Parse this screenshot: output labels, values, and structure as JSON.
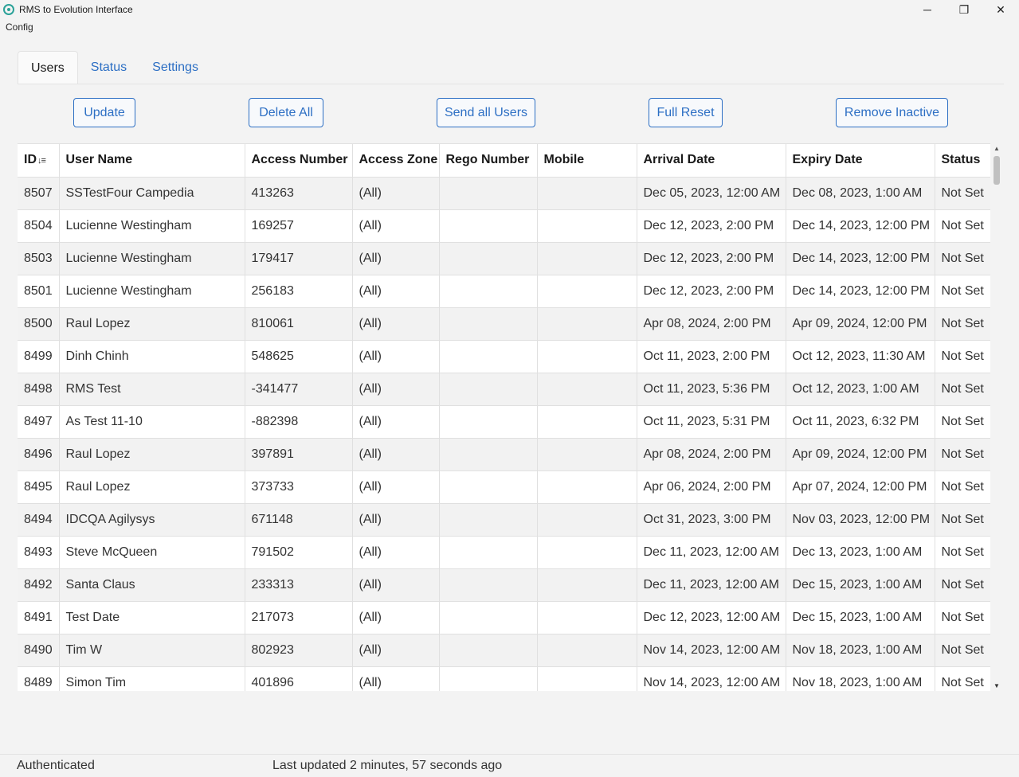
{
  "window": {
    "title": "RMS to Evolution Interface",
    "minimize": "─",
    "maximize": "❐",
    "close": "✕"
  },
  "menu": {
    "config": "Config"
  },
  "tabs": [
    {
      "label": "Users",
      "active": true
    },
    {
      "label": "Status",
      "active": false
    },
    {
      "label": "Settings",
      "active": false
    }
  ],
  "toolbar": {
    "update": "Update",
    "delete_all": "Delete All",
    "send_all_users": "Send all Users",
    "full_reset": "Full Reset",
    "remove_inactive": "Remove Inactive"
  },
  "grid": {
    "sort_icon": "↓≡",
    "columns": [
      "ID",
      "User Name",
      "Access Number",
      "Access Zone",
      "Rego Number",
      "Mobile",
      "Arrival Date",
      "Expiry Date",
      "Status"
    ],
    "rows": [
      [
        "8507",
        "SSTestFour Campedia",
        "413263",
        "(All)",
        "",
        "",
        "Dec 05, 2023, 12:00 AM",
        "Dec 08, 2023, 1:00 AM",
        "Not Set"
      ],
      [
        "8504",
        "Lucienne Westingham",
        "169257",
        "(All)",
        "",
        "",
        "Dec 12, 2023, 2:00 PM",
        "Dec 14, 2023, 12:00 PM",
        "Not Set"
      ],
      [
        "8503",
        "Lucienne Westingham",
        "179417",
        "(All)",
        "",
        "",
        "Dec 12, 2023, 2:00 PM",
        "Dec 14, 2023, 12:00 PM",
        "Not Set"
      ],
      [
        "8501",
        "Lucienne Westingham",
        "256183",
        "(All)",
        "",
        "",
        "Dec 12, 2023, 2:00 PM",
        "Dec 14, 2023, 12:00 PM",
        "Not Set"
      ],
      [
        "8500",
        "Raul Lopez",
        "810061",
        "(All)",
        "",
        "",
        "Apr 08, 2024, 2:00 PM",
        "Apr 09, 2024, 12:00 PM",
        "Not Set"
      ],
      [
        "8499",
        "Dinh Chinh",
        "548625",
        "(All)",
        "",
        "",
        "Oct 11, 2023, 2:00 PM",
        "Oct 12, 2023, 11:30 AM",
        "Not Set"
      ],
      [
        "8498",
        "RMS Test",
        "-341477",
        "(All)",
        "",
        "",
        "Oct 11, 2023, 5:36 PM",
        "Oct 12, 2023, 1:00 AM",
        "Not Set"
      ],
      [
        "8497",
        "As Test 11-10",
        "-882398",
        "(All)",
        "",
        "",
        "Oct 11, 2023, 5:31 PM",
        "Oct 11, 2023, 6:32 PM",
        "Not Set"
      ],
      [
        "8496",
        "Raul Lopez",
        "397891",
        "(All)",
        "",
        "",
        "Apr 08, 2024, 2:00 PM",
        "Apr 09, 2024, 12:00 PM",
        "Not Set"
      ],
      [
        "8495",
        "Raul Lopez",
        "373733",
        "(All)",
        "",
        "",
        "Apr 06, 2024, 2:00 PM",
        "Apr 07, 2024, 12:00 PM",
        "Not Set"
      ],
      [
        "8494",
        "IDCQA Agilysys",
        "671148",
        "(All)",
        "",
        "",
        "Oct 31, 2023, 3:00 PM",
        "Nov 03, 2023, 12:00 PM",
        "Not Set"
      ],
      [
        "8493",
        "Steve McQueen",
        "791502",
        "(All)",
        "",
        "",
        "Dec 11, 2023, 12:00 AM",
        "Dec 13, 2023, 1:00 AM",
        "Not Set"
      ],
      [
        "8492",
        "Santa Claus",
        "233313",
        "(All)",
        "",
        "",
        "Dec 11, 2023, 12:00 AM",
        "Dec 15, 2023, 1:00 AM",
        "Not Set"
      ],
      [
        "8491",
        "Test Date",
        "217073",
        "(All)",
        "",
        "",
        "Dec 12, 2023, 12:00 AM",
        "Dec 15, 2023, 1:00 AM",
        "Not Set"
      ],
      [
        "8490",
        "Tim W",
        "802923",
        "(All)",
        "",
        "",
        "Nov 14, 2023, 12:00 AM",
        "Nov 18, 2023, 1:00 AM",
        "Not Set"
      ],
      [
        "8489",
        "Simon Tim",
        "401896",
        "(All)",
        "",
        "",
        "Nov 14, 2023, 12:00 AM",
        "Nov 18, 2023, 1:00 AM",
        "Not Set"
      ]
    ]
  },
  "statusbar": {
    "auth": "Authenticated",
    "last_updated": "Last updated 2 minutes, 57 seconds ago"
  }
}
